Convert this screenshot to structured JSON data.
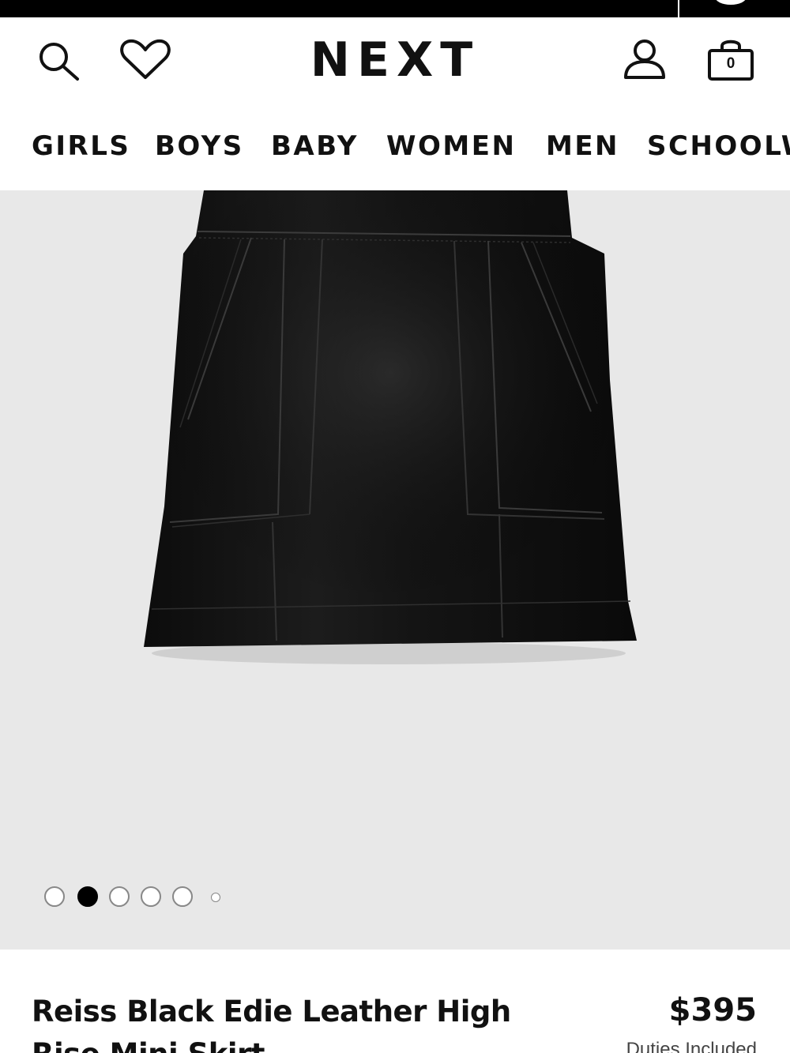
{
  "header": {
    "logo": "NEXT",
    "bag_count": "0",
    "icons": {
      "search": "search-icon",
      "wishlist": "heart-icon",
      "account": "user-icon",
      "bag": "shopping-bag-icon"
    }
  },
  "nav": {
    "items": [
      "GIRLS",
      "BOYS",
      "BABY",
      "WOMEN",
      "MEN",
      "SCHOOLW"
    ]
  },
  "gallery": {
    "image": "black-leather-mini-skirt",
    "image_count": 6,
    "active_index": 1
  },
  "product": {
    "title": "Reiss Black Edie Leather High Rise Mini Skirt",
    "price": "$395",
    "duties": "Duties Included"
  },
  "colors": {
    "background": "#ffffff",
    "gallery_bg": "#e8e8e8",
    "text": "#111111",
    "topbar": "#000000"
  }
}
